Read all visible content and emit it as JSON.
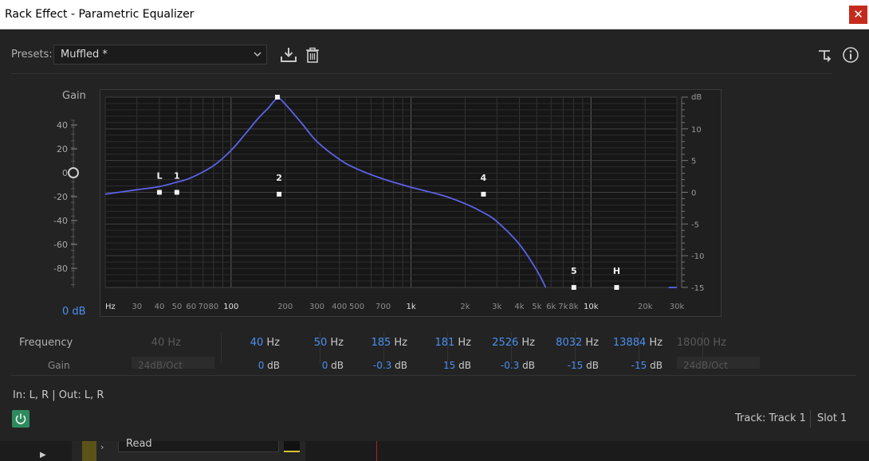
{
  "window": {
    "title": "Rack Effect - Parametric Equalizer",
    "close_glyph": "✕"
  },
  "presets": {
    "label": "Presets:",
    "value": "Muffled *"
  },
  "gain": {
    "label": "Gain",
    "value": "0 dB",
    "scale_labels": [
      "40",
      "20",
      "0",
      "-20",
      "-40",
      "-60",
      "-80"
    ],
    "knob_level": 0
  },
  "graph": {
    "freq_ticks": [
      {
        "label": "Hz",
        "hz": 20,
        "bright": true
      },
      {
        "label": "30",
        "hz": 30
      },
      {
        "label": "40",
        "hz": 40
      },
      {
        "label": "50",
        "hz": 50
      },
      {
        "label": "60",
        "hz": 60
      },
      {
        "label": "70",
        "hz": 70
      },
      {
        "label": "80",
        "hz": 80
      },
      {
        "label": "100",
        "hz": 100,
        "bright": true
      },
      {
        "label": "200",
        "hz": 200
      },
      {
        "label": "300",
        "hz": 300
      },
      {
        "label": "400",
        "hz": 400
      },
      {
        "label": "500",
        "hz": 500
      },
      {
        "label": "700",
        "hz": 700
      },
      {
        "label": "1k",
        "hz": 1000,
        "bright": true
      },
      {
        "label": "2k",
        "hz": 2000
      },
      {
        "label": "3k",
        "hz": 3000
      },
      {
        "label": "4k",
        "hz": 4000
      },
      {
        "label": "5k",
        "hz": 5000
      },
      {
        "label": "6k",
        "hz": 6000
      },
      {
        "label": "7k",
        "hz": 7000
      },
      {
        "label": "8k",
        "hz": 8000
      },
      {
        "label": "10k",
        "hz": 10000,
        "bright": true
      },
      {
        "label": "20k",
        "hz": 20000
      },
      {
        "label": "30k",
        "hz": 30000
      }
    ],
    "db_unit": "dB",
    "db_ticks": [
      {
        "label": "10",
        "db": 10
      },
      {
        "label": "5",
        "db": 5
      },
      {
        "label": "0",
        "db": 0
      },
      {
        "label": "-5",
        "db": -5
      },
      {
        "label": "-10",
        "db": -10
      },
      {
        "label": "-15",
        "db": -15
      }
    ],
    "db_range": [
      -15,
      15
    ],
    "curve": [
      [
        20,
        -0.3
      ],
      [
        30,
        0.4
      ],
      [
        40,
        0.9
      ],
      [
        50,
        1.6
      ],
      [
        60,
        2.3
      ],
      [
        80,
        4.2
      ],
      [
        100,
        6.6
      ],
      [
        120,
        9.2
      ],
      [
        140,
        11.5
      ],
      [
        160,
        13.2
      ],
      [
        181,
        14.8
      ],
      [
        200,
        13.9
      ],
      [
        250,
        10.7
      ],
      [
        300,
        8.0
      ],
      [
        400,
        5.2
      ],
      [
        500,
        3.7
      ],
      [
        700,
        2.1
      ],
      [
        1000,
        0.8
      ],
      [
        1500,
        -0.5
      ],
      [
        2000,
        -1.8
      ],
      [
        2526,
        -3.2
      ],
      [
        3000,
        -4.6
      ],
      [
        4000,
        -8.2
      ],
      [
        5000,
        -12.3
      ],
      [
        5600,
        -15
      ]
    ],
    "tail": [
      [
        27000,
        -15
      ],
      [
        30000,
        -15
      ]
    ],
    "handles": [
      {
        "label": "L",
        "hz": 40,
        "db": 0
      },
      {
        "label": "1",
        "hz": 50,
        "db": 0
      },
      {
        "label": "",
        "hz": 181,
        "db": 15
      },
      {
        "label": "2",
        "hz": 185,
        "db": -0.3
      },
      {
        "label": "4",
        "hz": 2526,
        "db": -0.3
      },
      {
        "label": "5",
        "hz": 8032,
        "db": -15
      },
      {
        "label": "H",
        "hz": 13884,
        "db": -15
      }
    ]
  },
  "bands": {
    "freq_label": "Frequency",
    "gain_label": "Gain",
    "unit_hz": "Hz",
    "unit_db": "dB",
    "columns": [
      {
        "freq": "40",
        "gain": "24dB/Oct",
        "enabled": false,
        "dropdown": true
      },
      {
        "freq": "40",
        "gain": "0",
        "enabled": true
      },
      {
        "freq": "50",
        "gain": "0",
        "enabled": true
      },
      {
        "freq": "185",
        "gain": "-0.3",
        "enabled": true
      },
      {
        "freq": "181",
        "gain": "15",
        "enabled": true
      },
      {
        "freq": "2526",
        "gain": "-0.3",
        "enabled": true
      },
      {
        "freq": "8032",
        "gain": "-15",
        "enabled": true
      },
      {
        "freq": "13884",
        "gain": "-15",
        "enabled": true
      },
      {
        "freq": "18000",
        "gain": "24dB/Oct",
        "enabled": false,
        "dropdown": true
      }
    ]
  },
  "io": {
    "label": "In: L, R | Out: L, R",
    "power": "on"
  },
  "footer": {
    "track": "Track: Track 1",
    "slot": "Slot 1"
  },
  "underlying": {
    "mode_select": "Read"
  },
  "colors": {
    "accent": "#4a8ff0",
    "curve": "#5b62e6",
    "power": "#2e8a5e",
    "close": "#c42b1c"
  }
}
